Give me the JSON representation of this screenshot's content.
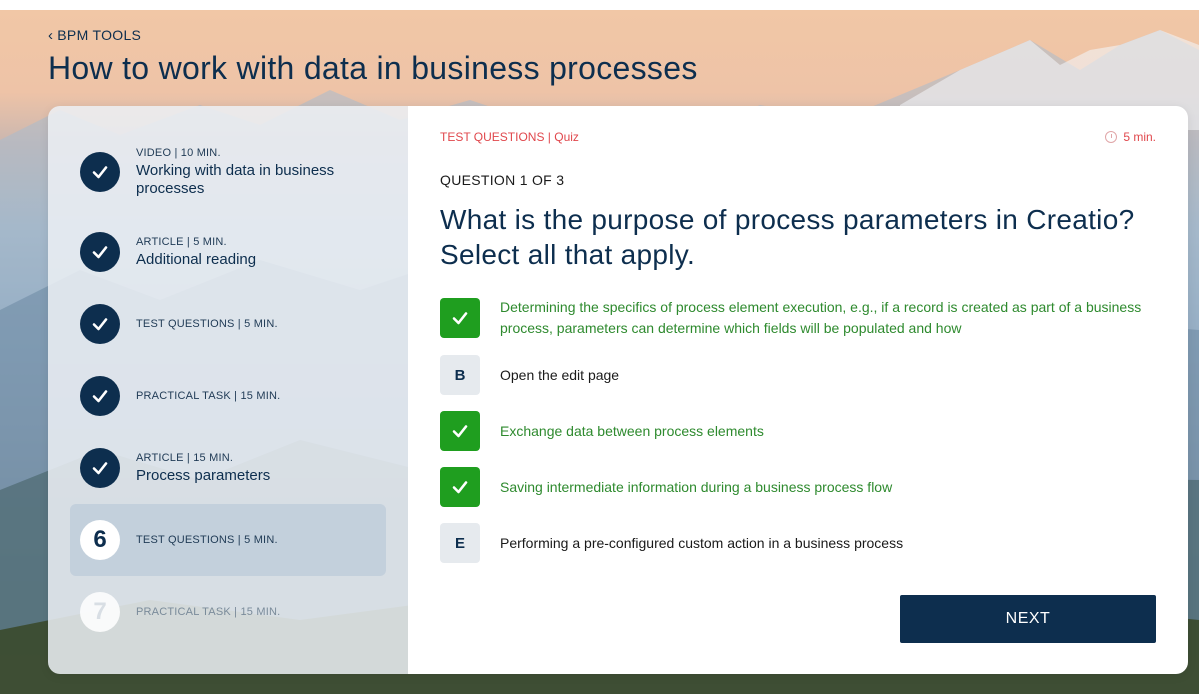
{
  "header": {
    "back_label": "BPM TOOLS",
    "title": "How to work with data in business processes"
  },
  "sidebar": {
    "steps": [
      {
        "meta": "VIDEO | 10 MIN.",
        "name": "Working with data in business processes",
        "state": "done",
        "icon": "check-icon"
      },
      {
        "meta": "ARTICLE | 5 MIN.",
        "name": "Additional reading",
        "state": "done",
        "icon": "check-icon"
      },
      {
        "meta": "TEST QUESTIONS | 5 MIN.",
        "name": "",
        "state": "done",
        "icon": "check-icon"
      },
      {
        "meta": "PRACTICAL TASK | 15 MIN.",
        "name": "",
        "state": "done",
        "icon": "check-icon"
      },
      {
        "meta": "ARTICLE | 15 MIN.",
        "name": "Process parameters",
        "state": "done",
        "icon": "check-icon"
      },
      {
        "meta": "TEST QUESTIONS | 5 MIN.",
        "name": "",
        "state": "active",
        "number": "6"
      },
      {
        "meta": "PRACTICAL TASK | 15 MIN.",
        "name": "",
        "state": "locked",
        "number": "7"
      }
    ]
  },
  "quiz": {
    "crumb": "TEST QUESTIONS | Quiz",
    "duration": "5 min.",
    "counter": "QUESTION 1 OF 3",
    "question": "What is the purpose of process parameters in Creatio? Select all that apply.",
    "options": [
      {
        "key": "A",
        "text": "Determining the specifics of process element execution, e.g., if a record is created as part of a business process, parameters can determine which fields will be populated and how",
        "selected": true
      },
      {
        "key": "B",
        "text": "Open the edit page",
        "selected": false
      },
      {
        "key": "C",
        "text": "Exchange data between process elements",
        "selected": true
      },
      {
        "key": "D",
        "text": "Saving intermediate information during a business process flow",
        "selected": true
      },
      {
        "key": "E",
        "text": "Performing a pre-configured custom action in a business process",
        "selected": false
      }
    ],
    "next_label": "NEXT"
  },
  "colors": {
    "navy": "#0d2e4e",
    "accent_red": "#e0474c",
    "correct_green": "#1f9e1f"
  }
}
